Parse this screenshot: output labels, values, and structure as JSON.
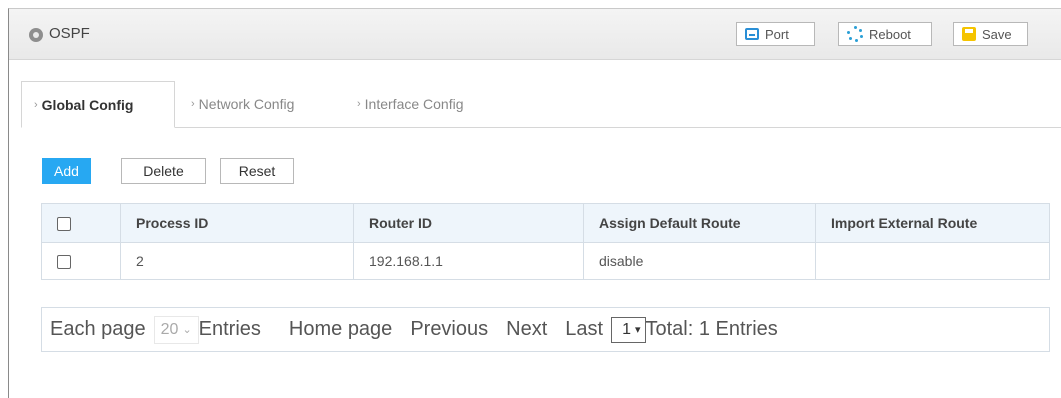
{
  "header": {
    "title": "OSPF",
    "buttons": {
      "port": "Port",
      "reboot": "Reboot",
      "save": "Save"
    }
  },
  "tabs": [
    {
      "label": "Global Config",
      "active": true
    },
    {
      "label": "Network Config",
      "active": false
    },
    {
      "label": "Interface Config",
      "active": false
    }
  ],
  "toolbar": {
    "add": "Add",
    "delete": "Delete",
    "reset": "Reset"
  },
  "table": {
    "columns": [
      "Process ID",
      "Router ID",
      "Assign Default Route",
      "Import External Route"
    ],
    "rows": [
      {
        "checked": false,
        "process_id": "2",
        "router_id": "192.168.1.1",
        "assign_default_route": "disable",
        "import_external_route": ""
      }
    ]
  },
  "pager": {
    "each_page": "Each page",
    "per_page": "20",
    "entries": "Entries",
    "home": "Home page",
    "previous": "Previous",
    "next": "Next",
    "last": "Last",
    "page": "1",
    "total": "Total: 1 Entries"
  },
  "colors": {
    "accent": "#27a8f2",
    "header_bg": "#e9e9e9",
    "table_header_bg": "#eef5fb",
    "save_icon": "#f5c400"
  }
}
